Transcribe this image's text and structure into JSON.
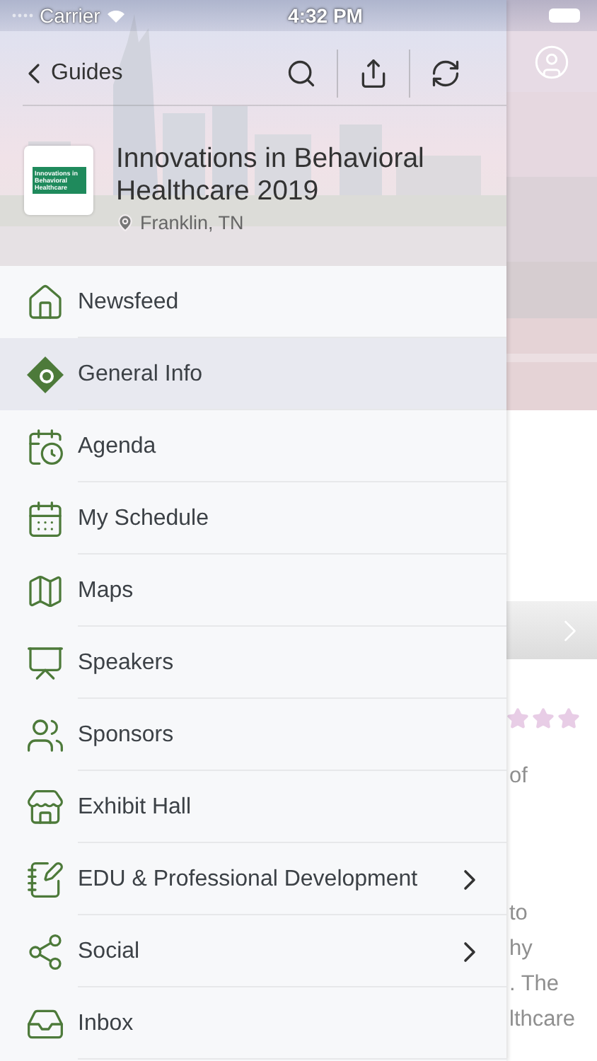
{
  "status_bar": {
    "carrier": "Carrier",
    "time": "4:32 PM"
  },
  "header": {
    "back_label": "Guides",
    "event": {
      "logo_text": "Innovations in Behavioral Healthcare",
      "title": "Innovations in Behavioral Healthcare 2019",
      "location": "Franklin, TN"
    }
  },
  "menu": [
    {
      "label": "Newsfeed",
      "selected": false,
      "has_submenu": false
    },
    {
      "label": "General Info",
      "selected": true,
      "has_submenu": false
    },
    {
      "label": "Agenda",
      "selected": false,
      "has_submenu": false
    },
    {
      "label": "My Schedule",
      "selected": false,
      "has_submenu": false
    },
    {
      "label": "Maps",
      "selected": false,
      "has_submenu": false
    },
    {
      "label": "Speakers",
      "selected": false,
      "has_submenu": false
    },
    {
      "label": "Sponsors",
      "selected": false,
      "has_submenu": false
    },
    {
      "label": "Exhibit Hall",
      "selected": false,
      "has_submenu": false
    },
    {
      "label": "EDU & Professional Development",
      "selected": false,
      "has_submenu": true
    },
    {
      "label": "Social",
      "selected": false,
      "has_submenu": true
    },
    {
      "label": "Inbox",
      "selected": false,
      "has_submenu": false
    }
  ],
  "background_page": {
    "stars": 3,
    "text_fragments": [
      "of",
      "to",
      "hy",
      ". The",
      "lthcare"
    ]
  }
}
